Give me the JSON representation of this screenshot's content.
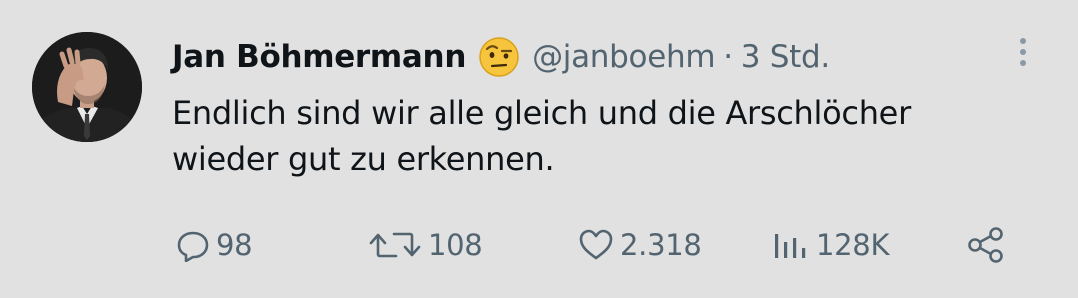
{
  "author": {
    "name": "Jan Böhmermann",
    "handle": "@janboehm",
    "separator": "·",
    "time": "3 Std."
  },
  "tweet": {
    "line1": "Endlich sind wir alle gleich und die Arschlöcher",
    "line2": "wieder gut zu erkennen."
  },
  "actions": {
    "replies": "98",
    "retweets": "108",
    "likes": "2.318",
    "views": "128K"
  },
  "icons": {
    "verified_emoji": "raised-eyebrow-emoji",
    "more": "more-vertical-icon",
    "reply": "reply-icon",
    "retweet": "retweet-icon",
    "like": "heart-icon",
    "views": "views-icon",
    "share": "share-icon"
  },
  "colors": {
    "background": "#e1e1e1",
    "text": "#0f1419",
    "muted": "#536471"
  }
}
